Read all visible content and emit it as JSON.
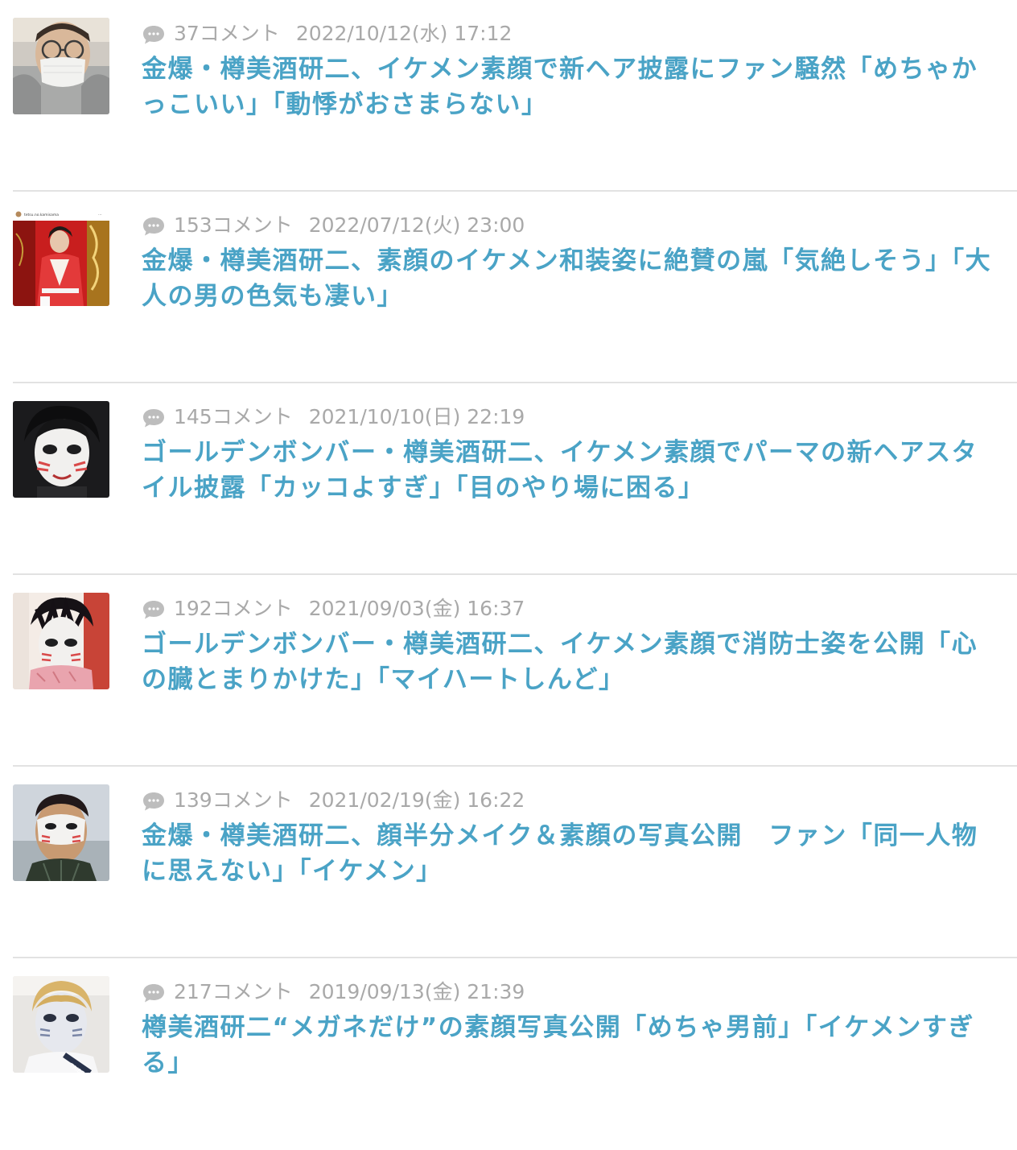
{
  "articles": [
    {
      "comments": "37コメント",
      "date": "2022/10/12(水) 17:12",
      "title": "金爆・樽美酒研二、イケメン素顔で新ヘア披露にファン騒然「めちゃかっこいい」「動悸がおさまらない」",
      "thumb_alt": "masked man with glasses"
    },
    {
      "comments": "153コメント",
      "date": "2022/07/12(火) 23:00",
      "title": "金爆・樽美酒研二、素顔のイケメン和装姿に絶賛の嵐「気絶しそう」「大人の男の色気も凄い」",
      "thumb_alt": "man in red kimono",
      "thumb_caption": "tetsu.no.kamisama"
    },
    {
      "comments": "145コメント",
      "date": "2021/10/10(日) 22:19",
      "title": "ゴールデンボンバー・樽美酒研二、イケメン素顔でパーマの新ヘアスタイル披露「カッコよすぎ」「目のやり場に困る」",
      "thumb_alt": "face paint makeup"
    },
    {
      "comments": "192コメント",
      "date": "2021/09/03(金) 16:37",
      "title": "ゴールデンボンバー・樽美酒研二、イケメン素顔で消防士姿を公開「心の臓とまりかけた」「マイハートしんど」",
      "thumb_alt": "face paint with pink scarf"
    },
    {
      "comments": "139コメント",
      "date": "2021/02/19(金) 16:22",
      "title": "金爆・樽美酒研二、顔半分メイク＆素顔の写真公開　ファン「同一人物に思えない」「イケメン」",
      "thumb_alt": "face paint outdoors"
    },
    {
      "comments": "217コメント",
      "date": "2019/09/13(金) 21:39",
      "title": "樽美酒研二“メガネだけ”の素顔写真公開「めちゃ男前」「イケメンすぎる」",
      "thumb_alt": "face paint blond hair"
    }
  ]
}
